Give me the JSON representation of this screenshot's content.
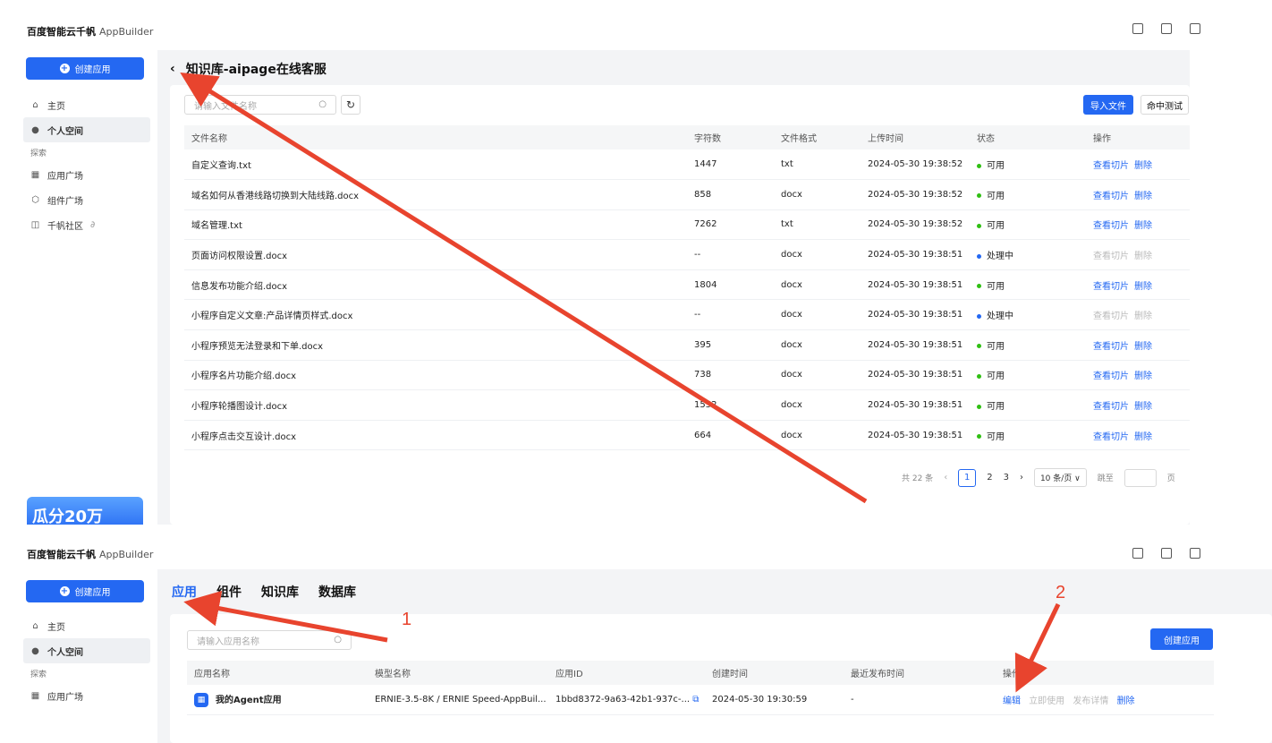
{
  "brand": {
    "name": "百度智能云千帆",
    "product": "AppBuilder"
  },
  "sidebar": {
    "create_label": "创建应用",
    "home": "主页",
    "personal": "个人空间",
    "explore_section": "探索",
    "app_square": "应用广场",
    "component_square": "组件广场",
    "community": "千帆社区"
  },
  "promo_text": "瓜分20万",
  "kb": {
    "title": "知识库-aipage在线客服",
    "search_placeholder": "请输入文件名称",
    "import_label": "导入文件",
    "hit_test_label": "命中测试",
    "columns": [
      "文件名称",
      "字符数",
      "文件格式",
      "上传时间",
      "状态",
      "操作"
    ],
    "rows": [
      {
        "name": "自定义查询.txt",
        "chars": "1447",
        "fmt": "txt",
        "time": "2024-05-30 19:38:52",
        "status": "可用"
      },
      {
        "name": "域名如何从香港线路切换到大陆线路.docx",
        "chars": "858",
        "fmt": "docx",
        "time": "2024-05-30 19:38:52",
        "status": "可用"
      },
      {
        "name": "域名管理.txt",
        "chars": "7262",
        "fmt": "txt",
        "time": "2024-05-30 19:38:52",
        "status": "可用"
      },
      {
        "name": "页面访问权限设置.docx",
        "chars": "--",
        "fmt": "docx",
        "time": "2024-05-30 19:38:51",
        "status": "处理中"
      },
      {
        "name": "信息发布功能介绍.docx",
        "chars": "1804",
        "fmt": "docx",
        "time": "2024-05-30 19:38:51",
        "status": "可用"
      },
      {
        "name": "小程序自定义文章:产品详情页样式.docx",
        "chars": "--",
        "fmt": "docx",
        "time": "2024-05-30 19:38:51",
        "status": "处理中"
      },
      {
        "name": "小程序预览无法登录和下单.docx",
        "chars": "395",
        "fmt": "docx",
        "time": "2024-05-30 19:38:51",
        "status": "可用"
      },
      {
        "name": "小程序名片功能介绍.docx",
        "chars": "738",
        "fmt": "docx",
        "time": "2024-05-30 19:38:51",
        "status": "可用"
      },
      {
        "name": "小程序轮播图设计.docx",
        "chars": "1552",
        "fmt": "docx",
        "time": "2024-05-30 19:38:51",
        "status": "可用"
      },
      {
        "name": "小程序点击交互设计.docx",
        "chars": "664",
        "fmt": "docx",
        "time": "2024-05-30 19:38:51",
        "status": "可用"
      }
    ],
    "op_view": "查看切片",
    "op_delete": "删除",
    "pagination": {
      "total": "共 22 条",
      "current": "1",
      "p2": "2",
      "p3": "3",
      "size": "10 条/页",
      "jump": "跳至",
      "page": "页"
    }
  },
  "apps": {
    "tabs": [
      "应用",
      "组件",
      "知识库",
      "数据库"
    ],
    "search_placeholder": "请输入应用名称",
    "create_label": "创建应用",
    "columns": [
      "应用名称",
      "模型名称",
      "应用ID",
      "创建时间",
      "最近发布时间",
      "操作"
    ],
    "row": {
      "name": "我的Agent应用",
      "model": "ERNIE-3.5-8K / ERNIE Speed-AppBuil...",
      "id": "1bbd8372-9a63-42b1-937c-...",
      "created": "2024-05-30 19:30:59",
      "published": "-",
      "op_edit": "编辑",
      "op_use": "立即使用",
      "op_detail": "发布详情",
      "op_delete": "删除"
    }
  },
  "annotations": {
    "one": "1",
    "two": "2"
  }
}
